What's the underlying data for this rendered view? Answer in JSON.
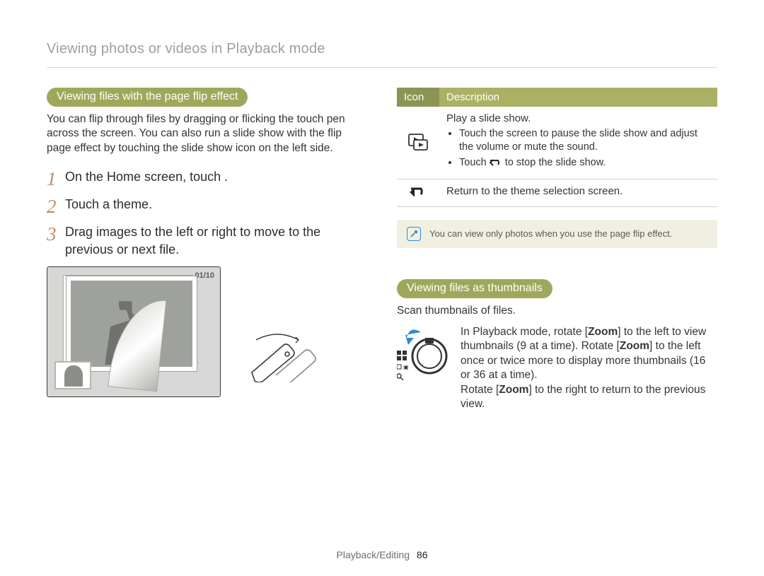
{
  "breadcrumb": "Viewing photos or videos in Playback mode",
  "section_a": {
    "title": "Viewing files with the page flip effect",
    "intro": "You can flip through files by dragging or flicking the touch pen across the screen. You can also run a slide show with the flip page effect by touching the slide show icon on the left side.",
    "steps": [
      "On the Home screen, touch       .",
      "Touch a theme.",
      "Drag images to the left or right to move to the previous or next file."
    ],
    "counter": "01/10"
  },
  "table": {
    "head_icon": "Icon",
    "head_desc": "Description",
    "row1": {
      "line1": "Play a slide show.",
      "bullet1": "Touch the screen to pause the slide show and adjust the volume or mute the sound.",
      "bullet2a": "Touch ",
      "bullet2b": " to stop the slide show."
    },
    "row2": "Return to the theme selection screen."
  },
  "note": "You can view only photos when you use the page flip effect.",
  "section_b": {
    "title": "Viewing files as thumbnails",
    "intro": "Scan thumbnails of files.",
    "body_a": "In Playback mode, rotate [",
    "zoom": "Zoom",
    "body_b": "] to the left to view thumbnails (9 at a time). Rotate [",
    "body_c": "] to the left once or twice more to display more thumbnails (16 or 36 at a time).",
    "body_d": "Rotate [",
    "body_e": "] to the right to return to the previous view."
  },
  "footer": {
    "section": "Playback/Editing",
    "page": "86"
  }
}
